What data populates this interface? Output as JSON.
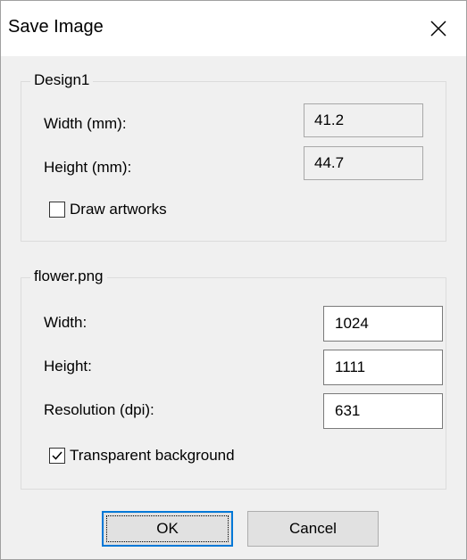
{
  "window": {
    "title": "Save Image",
    "close_icon": "close-icon"
  },
  "design_group": {
    "legend": "Design1",
    "width_label": "Width (mm):",
    "width_value": "41.2",
    "height_label": "Height (mm):",
    "height_value": "44.7",
    "draw_artworks_label": "Draw artworks",
    "draw_artworks_checked": false
  },
  "image_group": {
    "legend": "flower.png",
    "width_label": "Width:",
    "width_value": "1024",
    "height_label": "Height:",
    "height_value": "1111",
    "resolution_label": "Resolution (dpi):",
    "resolution_value": "631",
    "transparent_label": "Transparent background",
    "transparent_checked": true
  },
  "buttons": {
    "ok_label": "OK",
    "cancel_label": "Cancel"
  },
  "colors": {
    "window_bg": "#f0f0f0",
    "focus_border": "#0078d7"
  }
}
